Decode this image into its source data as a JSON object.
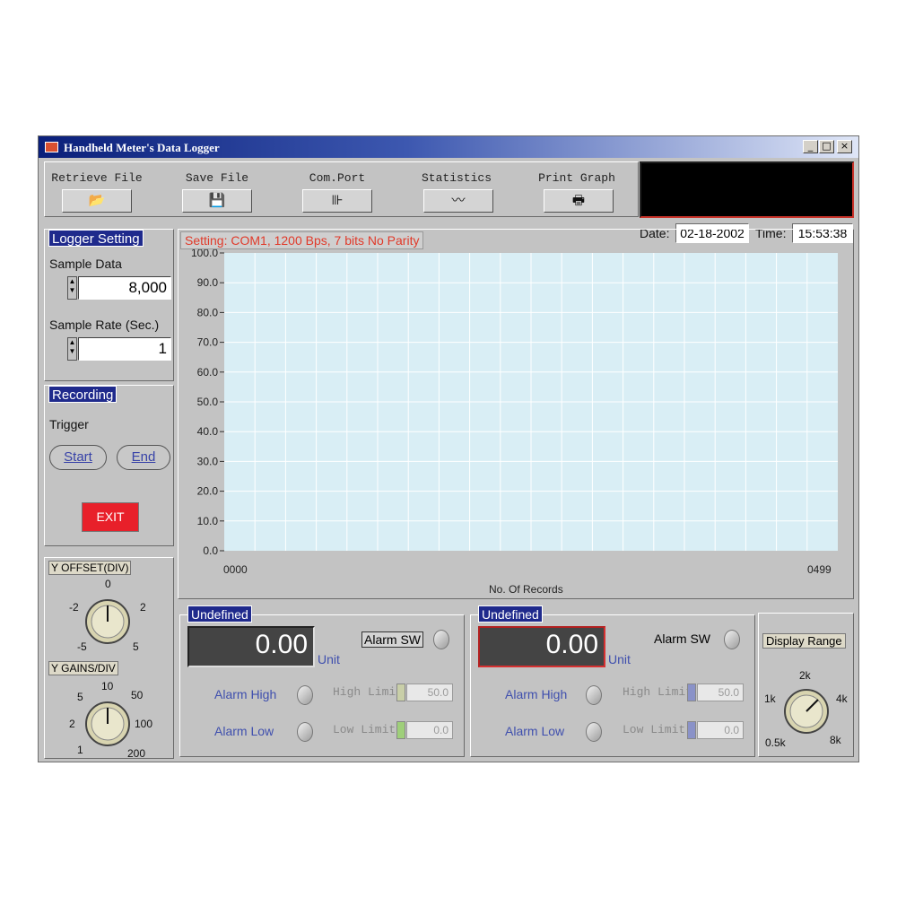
{
  "window": {
    "title": "Handheld Meter's Data Logger",
    "controls": [
      "_",
      "□",
      "×"
    ]
  },
  "toolbar": {
    "buttons": [
      {
        "label": "Retrieve File",
        "icon": "open-folder-icon",
        "glyph": "📂"
      },
      {
        "label": "Save File",
        "icon": "floppy-disk-icon",
        "glyph": "💾"
      },
      {
        "label": "Com.Port",
        "icon": "port-connector-icon",
        "glyph": "⊪"
      },
      {
        "label": "Statistics",
        "icon": "statistics-icon",
        "glyph": "〰"
      },
      {
        "label": "Print Graph",
        "icon": "printer-icon",
        "glyph": "🖶"
      }
    ]
  },
  "datetime": {
    "date_label": "Date:",
    "date": "02-18-2002",
    "time_label": "Time:",
    "time": "15:53:38"
  },
  "logger": {
    "title": "Logger Setting",
    "sample_data_label": "Sample Data",
    "sample_data_value": "8,000",
    "sample_rate_label": "Sample Rate (Sec.)",
    "sample_rate_value": "1"
  },
  "recording": {
    "title": "Recording",
    "trigger_label": "Trigger",
    "start_label": "Start",
    "end_label": "End",
    "exit_label": "EXIT"
  },
  "y_offset": {
    "title": "Y OFFSET(DIV)",
    "ticks": [
      "0",
      "-2",
      "2",
      "-5",
      "5"
    ]
  },
  "y_gains": {
    "title": "Y GAINS/DIV",
    "ticks": [
      "10",
      "5",
      "50",
      "2",
      "100",
      "1",
      "200"
    ]
  },
  "graph": {
    "setting_text": "Setting: COM1, 1200 Bps, 7 bits No Parity",
    "x_first": "0000",
    "x_last": "0499",
    "xlabel": "No. Of Records"
  },
  "chart_data": {
    "type": "line",
    "xlabel": "No. Of Records",
    "ylabel": "",
    "ylim": [
      0,
      100
    ],
    "xlim": [
      0,
      499
    ],
    "y_ticks": [
      "100.0",
      "90.0",
      "80.0",
      "70.0",
      "60.0",
      "50.0",
      "40.0",
      "30.0",
      "20.0",
      "10.0",
      "0.0"
    ],
    "x_tick_labels": [
      "0000",
      "0499"
    ],
    "grid": true,
    "series": []
  },
  "channel1": {
    "title": "Undefined",
    "value": "0.00",
    "unit": "Unit",
    "alarm_sw": "Alarm SW",
    "alarm_high": "Alarm High",
    "alarm_low": "Alarm Low",
    "high_limit_label": "High Limit",
    "high_limit_value": "50.0",
    "low_limit_label": "Low Limit",
    "low_limit_value": "0.0"
  },
  "channel2": {
    "title": "Undefined",
    "value": "0.00",
    "unit": "Unit",
    "alarm_sw": "Alarm SW",
    "alarm_high": "Alarm High",
    "alarm_low": "Alarm Low",
    "high_limit_label": "High Limit",
    "high_limit_value": "50.0",
    "low_limit_label": "Low Limit",
    "low_limit_value": "0.0"
  },
  "display_range": {
    "title": "Display Range",
    "ticks": [
      "2k",
      "1k",
      "4k",
      "0.5k",
      "8k"
    ]
  },
  "colors": {
    "title_bar": "#0a1f7a",
    "plot_bg": "#d9eef5",
    "grid": "#ffffff",
    "group_title": "#1f2a8c",
    "exit_button": "#e8202a",
    "setting_text": "#e03a2a"
  }
}
